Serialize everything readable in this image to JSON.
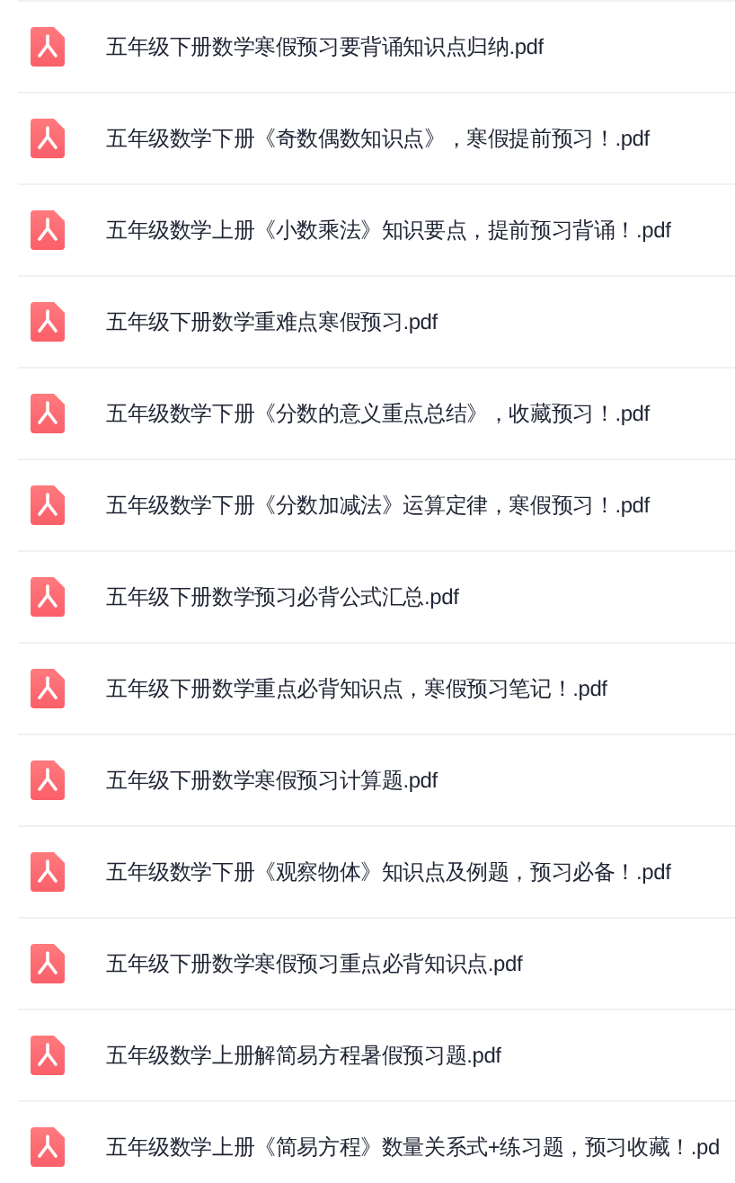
{
  "files": [
    {
      "name": "五年级下册数学寒假预习要背诵知识点归纳.pdf"
    },
    {
      "name": "五年级数学下册《奇数偶数知识点》，寒假提前预习！.pdf"
    },
    {
      "name": "五年级数学上册《小数乘法》知识要点，提前预习背诵！.pdf"
    },
    {
      "name": "五年级下册数学重难点寒假预习.pdf"
    },
    {
      "name": "五年级数学下册《分数的意义重点总结》，收藏预习！.pdf"
    },
    {
      "name": "五年级数学下册《分数加减法》运算定律，寒假预习！.pdf"
    },
    {
      "name": "五年级下册数学预习必背公式汇总.pdf"
    },
    {
      "name": "五年级下册数学重点必背知识点，寒假预习笔记！.pdf"
    },
    {
      "name": "五年级下册数学寒假预习计算题.pdf"
    },
    {
      "name": "五年级数学下册《观察物体》知识点及例题，预习必备！.pdf"
    },
    {
      "name": "五年级下册数学寒假预习重点必背知识点.pdf"
    },
    {
      "name": "五年级数学上册解简易方程暑假预习题.pdf"
    },
    {
      "name": "五年级数学上册《简易方程》数量关系式+练习题，预习收藏！.pd"
    }
  ]
}
